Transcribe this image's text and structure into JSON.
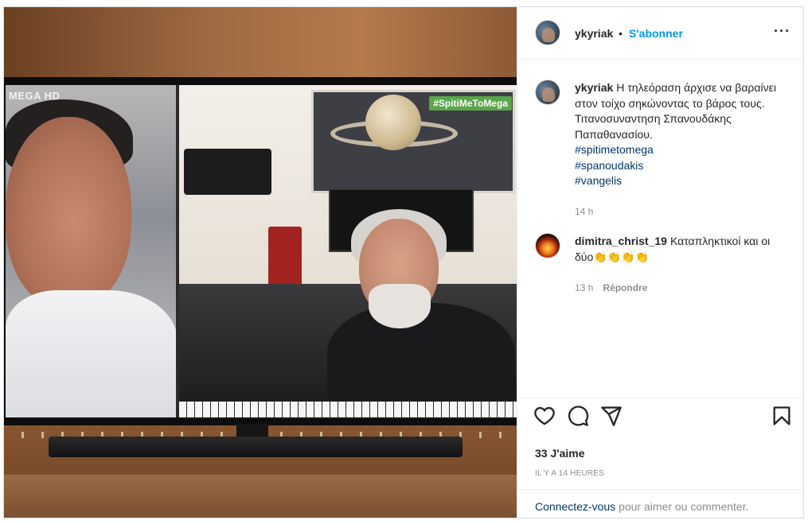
{
  "post": {
    "username": "ykyriak",
    "separator": "•",
    "follow_label": "S'abonner",
    "more_label": "···"
  },
  "photo": {
    "channel_logo": "MEGA HD",
    "hashtag_bug": "#SpitiMeToMega"
  },
  "caption": {
    "username": "ykyriak",
    "text": "Η τηλεόραση άρχισε να βαραίνει στον τοίχο σηκώνοντας το βάρος τους. Τιτανοσυναντηση Σπανουδάκης Παπαθανασίου.",
    "hashtags": [
      "#spitimetomega",
      "#spanoudakis",
      "#vangelis"
    ],
    "time": "14 h"
  },
  "comment": {
    "username": "dimitra_christ_19",
    "text": "Καταπληκτικοί και οι δύο👏👏👏👏",
    "time": "13 h",
    "reply_label": "Répondre"
  },
  "actions": {
    "icons": [
      "heart-icon",
      "comment-icon",
      "share-icon",
      "save-icon"
    ],
    "likes": "33 J'aime",
    "post_age": "IL Y A 14 HEURES"
  },
  "login": {
    "link_label": "Connectez-vous",
    "rest_text": " pour aimer ou commenter."
  },
  "colors": {
    "accent": "#0095f6",
    "hashtag": "#00376b",
    "muted": "#8e8e8e",
    "text": "#262626"
  }
}
